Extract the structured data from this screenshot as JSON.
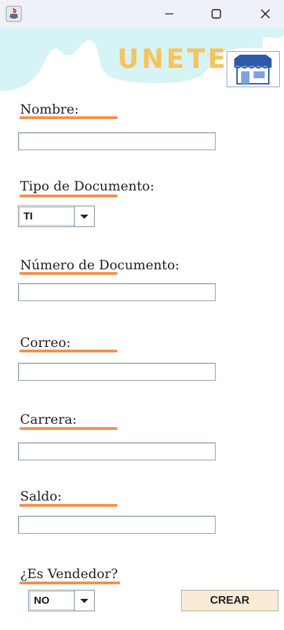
{
  "window": {
    "title": "",
    "app_icon": "java-cup-icon",
    "controls": [
      "minimize-icon",
      "maximize-icon",
      "close-icon"
    ]
  },
  "header": {
    "title": "UNETE",
    "title_color": "#f8c35c",
    "background_color": "#d6f3f5",
    "logo": "store-icon"
  },
  "form": {
    "nombre": {
      "label": "Nombre:",
      "value": ""
    },
    "tipo_documento": {
      "label": "Tipo de Documento:",
      "selected": "TI"
    },
    "numero_documento": {
      "label": "Número de Documento:",
      "value": ""
    },
    "correo": {
      "label": "Correo:",
      "value": ""
    },
    "carrera": {
      "label": "Carrera:",
      "value": ""
    },
    "saldo": {
      "label": "Saldo:",
      "value": ""
    },
    "es_vendedor": {
      "label": "¿Es Vendedor?",
      "selected": "NO"
    }
  },
  "actions": {
    "crear_label": "CREAR"
  },
  "colors": {
    "underline": "#f3904a",
    "button_bg": "#fbead6"
  }
}
